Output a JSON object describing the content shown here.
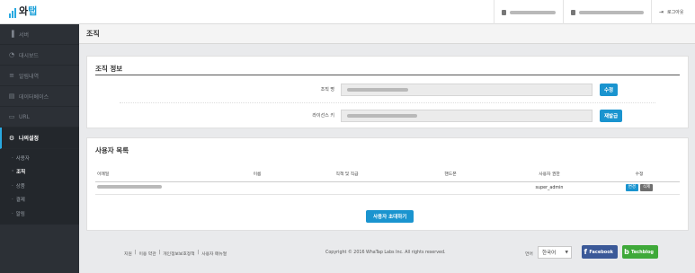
{
  "app": {
    "logo_text_a": "와",
    "logo_text_b": "탭"
  },
  "topbar": {
    "logout_label": "로그아웃"
  },
  "sidebar": {
    "items": [
      {
        "label": "서버",
        "icon": "bar-chart-icon"
      },
      {
        "label": "대시보드",
        "icon": "dashboard-icon"
      },
      {
        "label": "알림내역",
        "icon": "list-icon"
      },
      {
        "label": "데이터베이스",
        "icon": "database-icon"
      },
      {
        "label": "URL",
        "icon": "url-icon"
      },
      {
        "label": "나의설정",
        "icon": "gear-icon"
      }
    ],
    "sub_items": [
      {
        "label": "사용자"
      },
      {
        "label": "조직"
      },
      {
        "label": "상품"
      },
      {
        "label": "결제"
      },
      {
        "label": "알림"
      }
    ]
  },
  "page": {
    "title": "조직"
  },
  "org_info": {
    "title": "조직 정보",
    "name_label": "조직 명",
    "name_button": "수정",
    "license_label": "라이선스 키",
    "license_button": "재발급"
  },
  "user_list": {
    "title": "사용자 목록",
    "columns": [
      "이메일",
      "이름",
      "직책 및 직급",
      "핸드폰",
      "사용자 권한",
      "수정"
    ],
    "rows": [
      {
        "role": "super_admin",
        "edit_label": "변경",
        "delete_label": "삭제"
      }
    ],
    "invite_button": "사용자 초대하기"
  },
  "footer": {
    "links": [
      "지원",
      "이용 약관",
      "개인정보보호정책",
      "사용자 매뉴얼"
    ],
    "copyright": "Copyright © 2016 WhaTap Labs Inc. All rights reserved.",
    "lang_label": "언어",
    "lang_value": "한국어",
    "facebook_label": "Facebook",
    "techblog_label": "Techblog"
  },
  "colors": {
    "accent": "#1a94cf",
    "sidebar_bg": "#2c3036",
    "facebook": "#3b5998",
    "techblog": "#3fa93a"
  }
}
